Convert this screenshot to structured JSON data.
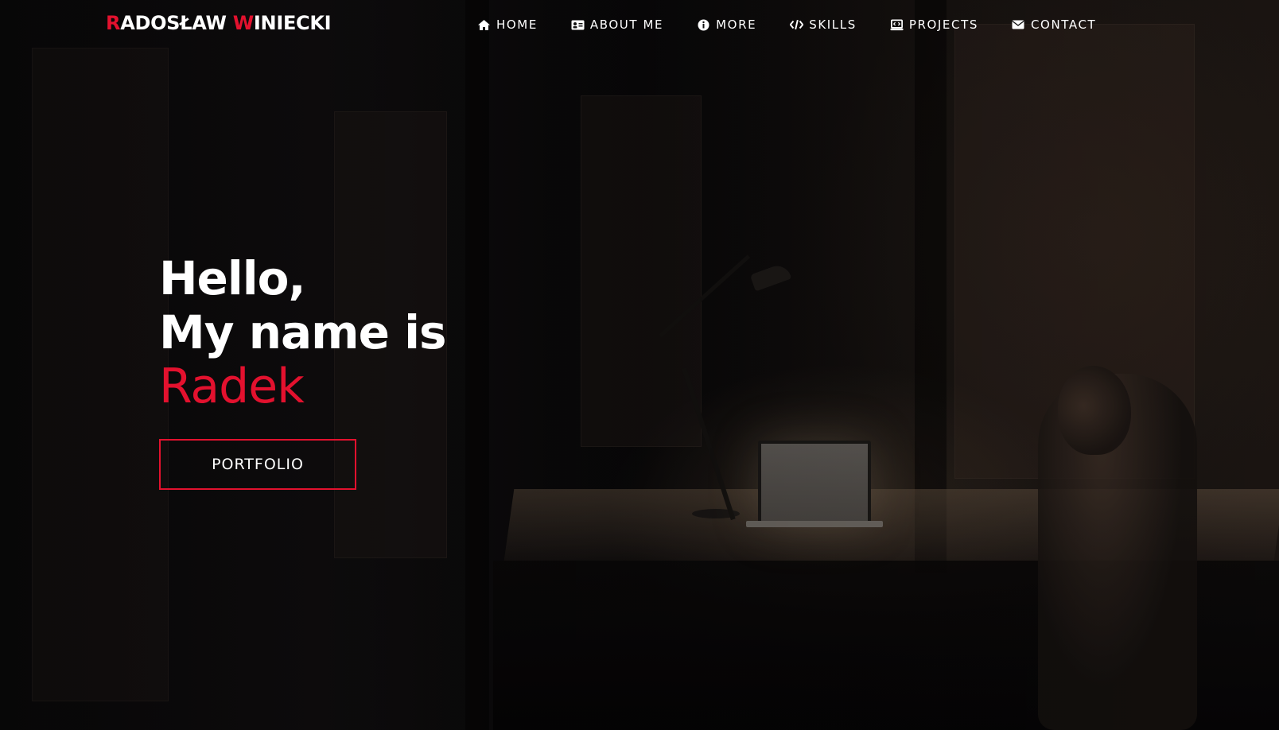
{
  "brand": {
    "first_initial": "R",
    "first_rest": "ADOSŁAW",
    "last_initial": "W",
    "last_rest": "INIECKI",
    "accent_color": "#e3112e"
  },
  "nav": {
    "items": [
      {
        "label": "HOME",
        "icon": "home-icon"
      },
      {
        "label": "ABOUT ME",
        "icon": "id-card-icon"
      },
      {
        "label": "MORE",
        "icon": "info-circle-icon"
      },
      {
        "label": "SKILLS",
        "icon": "code-icon"
      },
      {
        "label": "PROJECTS",
        "icon": "laptop-code-icon"
      },
      {
        "label": "CONTACT",
        "icon": "envelope-icon"
      }
    ]
  },
  "hero": {
    "greeting": "Hello,",
    "intro": "My name is",
    "name": "Radek",
    "button_label": "PORTFOLIO"
  },
  "colors": {
    "accent": "#e3112e",
    "text": "#ffffff",
    "background": "#050405"
  }
}
